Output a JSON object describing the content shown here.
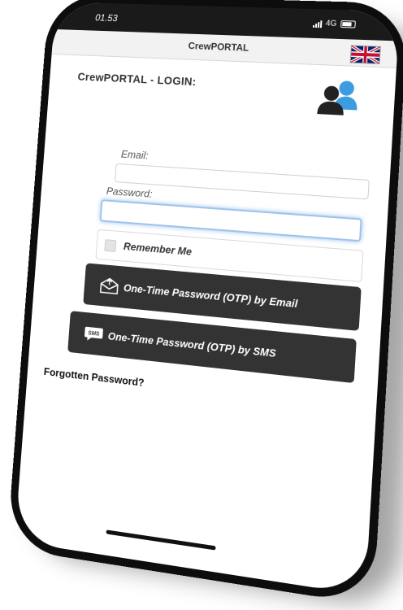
{
  "status_bar": {
    "time": "01.53",
    "network": "4G"
  },
  "header": {
    "title": "CrewPORTAL",
    "language_icon": "uk-flag-icon"
  },
  "login": {
    "heading": "CrewPORTAL - LOGIN:",
    "users_icon": "users-icon",
    "email_label": "Email:",
    "email_value": "",
    "password_label": "Password:",
    "password_value": "",
    "remember_label": "Remember Me",
    "remember_checked": false,
    "otp_email_label": "One-Time Password (OTP) by Email",
    "otp_sms_label": "One-Time Password (OTP) by SMS",
    "forgot_label": "Forgotten Password?"
  },
  "colors": {
    "button_bg": "#333333",
    "focus_ring": "#9ec3ea",
    "user_icon_blue": "#3d9ce0",
    "user_icon_dark": "#222222"
  }
}
